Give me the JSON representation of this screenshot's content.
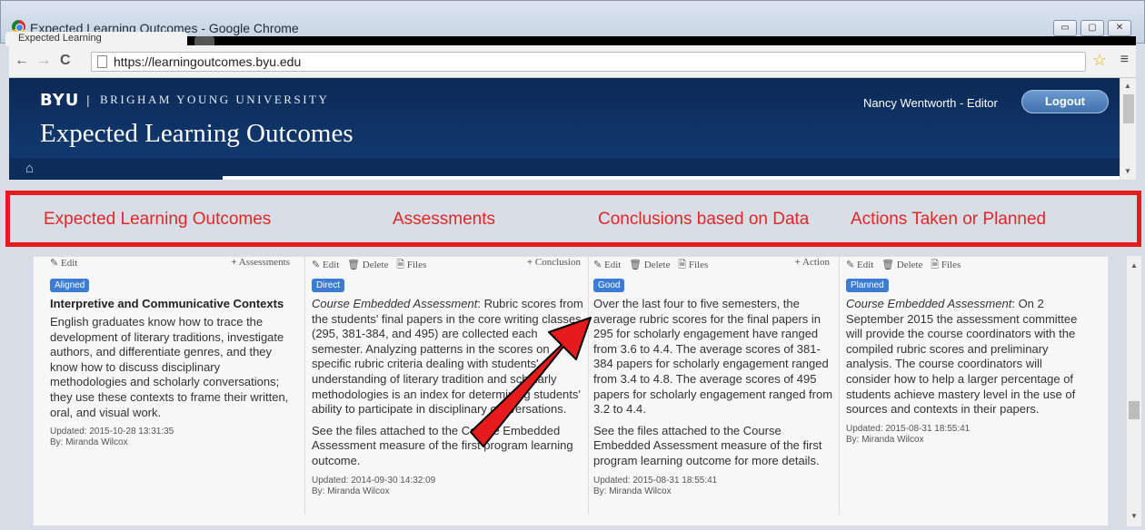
{
  "window": {
    "title": "Expected Learning Outcomes - Google Chrome",
    "tab_title": "Expected Learning",
    "minimize": "▭",
    "maximize": "▢",
    "close": "✕"
  },
  "browser": {
    "url": "https://learningoutcomes.byu.edu",
    "back_icon": "←",
    "forward_icon": "→",
    "reload_icon": "C",
    "star_icon": "☆",
    "menu_icon": "≡"
  },
  "header": {
    "logo": "BYU",
    "divider": "|",
    "university": "BRIGHAM YOUNG UNIVERSITY",
    "title": "Expected Learning Outcomes",
    "user": "Nancy Wentworth - Editor",
    "logout": "Logout",
    "home_icon": "⌂"
  },
  "callout": {
    "labels": [
      "Expected Learning Outcomes",
      "Assessments",
      "Conclusions based on Data",
      "Actions Taken or Planned"
    ],
    "color": "#e61b1b"
  },
  "columns": {
    "outcome": {
      "edit": "Edit",
      "add": "Assessments",
      "badge": "Aligned",
      "title": "Interpretive and Communicative Contexts",
      "text": "English graduates know how to trace the development of literary traditions, investigate authors, and differentiate genres, and they know how to discuss disciplinary methodologies and scholarly conversations; they use these contexts to frame their written, oral, and visual work.",
      "updated": "Updated: 2015-10-28 13:31:35",
      "by": "By: Miranda Wilcox"
    },
    "assessment": {
      "edit": "Edit",
      "delete": "Delete",
      "files": "Files",
      "add": "Conclusion",
      "badge": "Direct",
      "italic": "Course Embedded Assessment",
      "text": ": Rubric scores from the students' final papers in the core writing classes (295, 381-384, and 495) are collected each semester. Analyzing patterns in the scores on specific rubric criteria dealing with students' understanding of literary tradition and scholarly methodologies is an index for determining students' ability to participate in disciplinary conversations.",
      "text2": "See the files attached to the Course Embedded Assessment measure of the first program learning outcome.",
      "updated": "Updated: 2014-09-30 14:32:09",
      "by": "By: Miranda Wilcox"
    },
    "conclusion": {
      "edit": "Edit",
      "delete": "Delete",
      "files": "Files",
      "add": "Action",
      "badge": "Good",
      "text": "Over the last four to five semesters, the average rubric scores for the final papers in 295 for scholarly engagement have ranged from 3.6 to 4.4. The average scores of 381-384 papers for scholarly engagement ranged from 3.4 to 4.8. The average scores of 495 papers for scholarly engagement ranged from 3.2 to 4.4.",
      "text2": "See the files attached to the Course Embedded Assessment measure of the first program learning outcome for more details.",
      "updated": "Updated: 2015-08-31 18:55:41",
      "by": "By: Miranda Wilcox"
    },
    "action": {
      "edit": "Edit",
      "delete": "Delete",
      "files": "Files",
      "badge": "Planned",
      "italic": "Course Embedded Assessment",
      "text": ": On 2 September 2015 the assessment committee will provide the course coordinators with the compiled rubric scores and preliminary analysis. The course coordinators will consider how to help a larger percentage of students achieve mastery level in the use of sources and contexts in their papers.",
      "updated": "Updated: 2015-08-31 18:55:41",
      "by": "By: Miranda Wilcox"
    }
  },
  "colors": {
    "header_bg": "#0c2955",
    "badge_blue": "#3a7cd6",
    "arrow_red": "#e61b1b"
  }
}
